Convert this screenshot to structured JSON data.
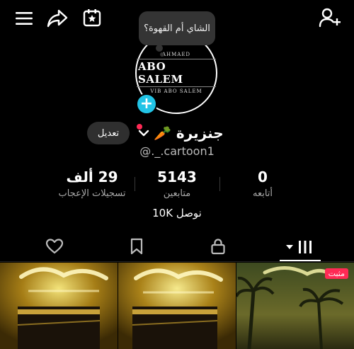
{
  "header": {
    "menu_icon": "hamburger-icon",
    "share_icon": "share-arrow-icon",
    "calendar_icon": "star-calendar-icon",
    "add_friend_icon": "add-user-icon"
  },
  "profile": {
    "note": "الشاي أم القهوة؟",
    "avatar_top": "AHMAED",
    "avatar_main": "ABO SALEM",
    "avatar_bottom": "VIB ABO SALEM",
    "add_badge": "+",
    "display_name": "جنزيرة 🥕",
    "username": "@._.cartoon1",
    "edit_label": "تعديل"
  },
  "stats": [
    {
      "value": "0",
      "label": "أتابعه"
    },
    {
      "value": "5143",
      "label": "متابعين"
    },
    {
      "value": "29 ألف",
      "label": "تسجيلات الإعجاب"
    }
  ],
  "reach": "نوصل 10K",
  "tabs": {
    "active": "videos-grid",
    "icons": [
      "grid-icon",
      "lock-icon",
      "bookmark-icon",
      "heart-icon"
    ]
  },
  "grid": {
    "pinned_label": "مثبت"
  },
  "colors": {
    "background": "#000000",
    "accent": "#22c4e6",
    "pinned": "#ff2a55"
  }
}
